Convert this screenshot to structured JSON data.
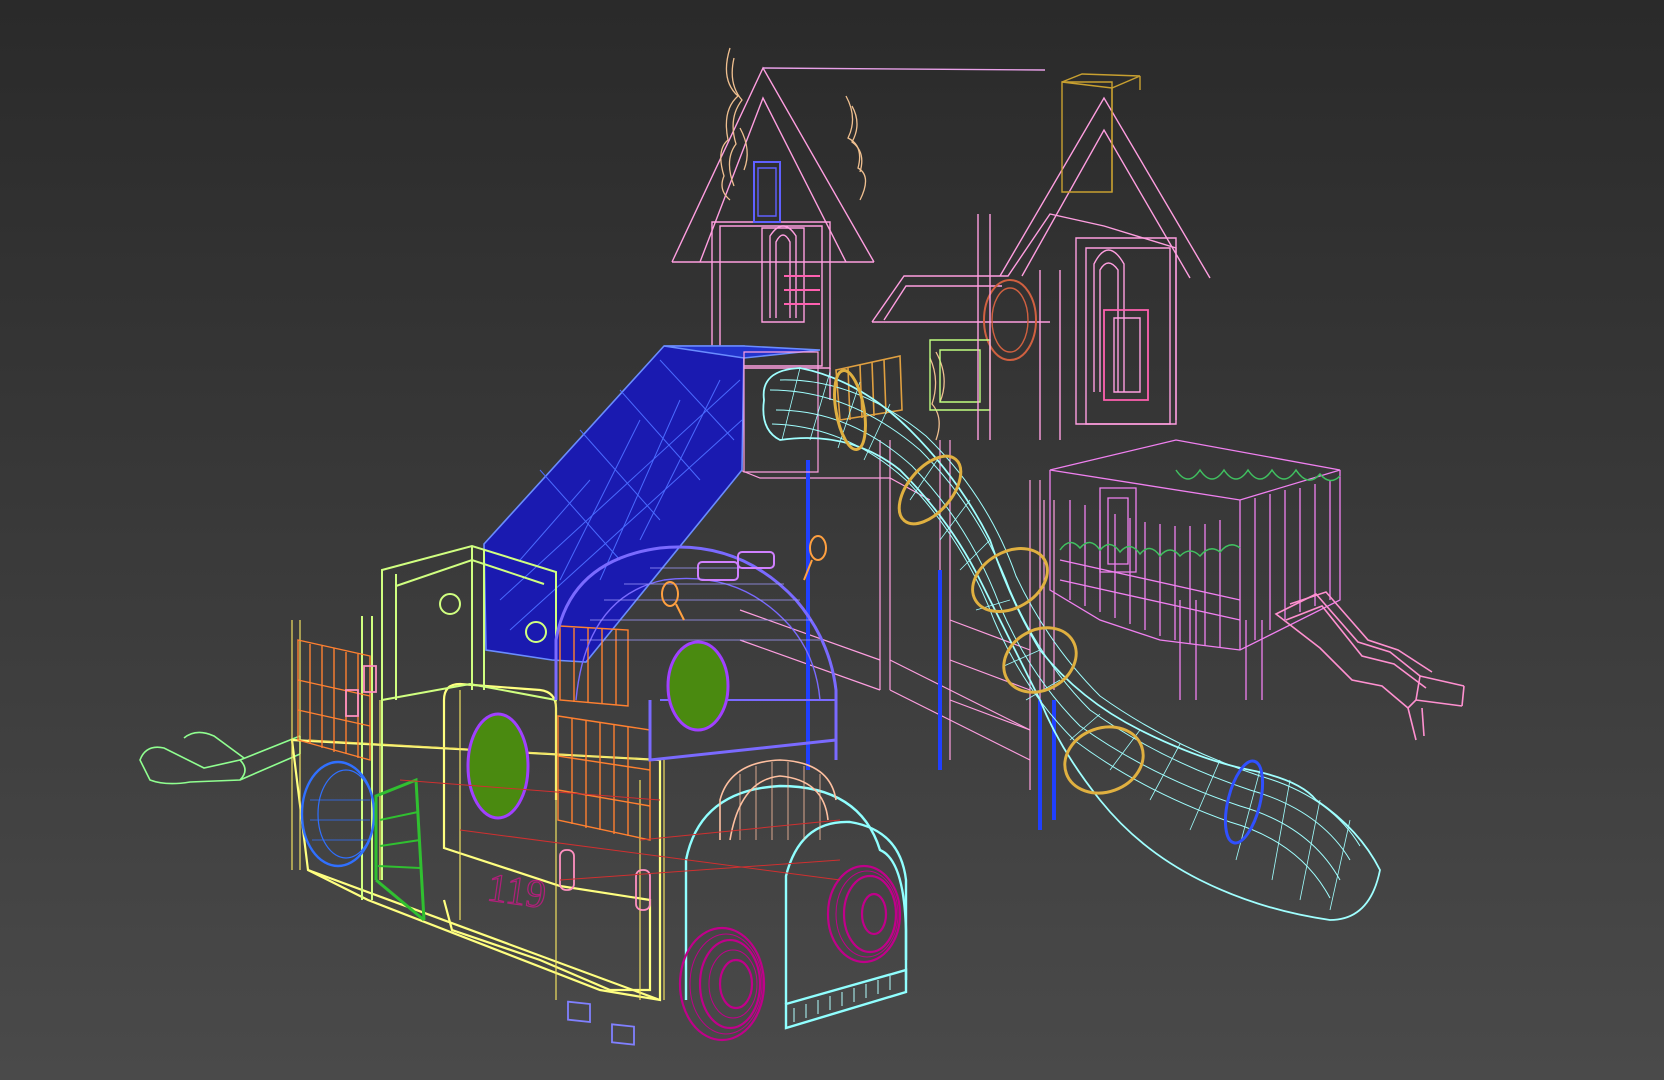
{
  "viewport": {
    "background_top": "#2a2a2a",
    "background_bottom": "#4a4a4a"
  },
  "model": {
    "fire_truck_decal": "119"
  },
  "colors": {
    "house_wire": "#ff9ee0",
    "roof_wire": "#e8a0e8",
    "flame_wire": "#f0c090",
    "chimney_wire": "#c8a030",
    "slide_ramp": "#1a1ab0",
    "slide_ramp_wire": "#6a8cff",
    "tube_slide_wire": "#a0ffff",
    "tube_rings": "#e0b040",
    "tube_blue_ring": "#3050ff",
    "fence_wire": "#f080f0",
    "fence_trim": "#40c060",
    "small_slide_wire": "#ff90d0",
    "truck_body_wire": "#ffff80",
    "truck_cab_wire": "#d0ff80",
    "truck_arch_wire": "#7a6aff",
    "truck_front_arch_wire": "#90ffff",
    "truck_back_arch_wire": "#ffc0a0",
    "truck_panel_orange": "#ff8030",
    "truck_window_green": "#70c000",
    "truck_wheel_magenta": "#c0008a",
    "truck_porthole_blue": "#3070ff",
    "ladder_green": "#30c030",
    "support_posts_blue": "#2040ff",
    "rocker_wire": "#90ff90"
  }
}
